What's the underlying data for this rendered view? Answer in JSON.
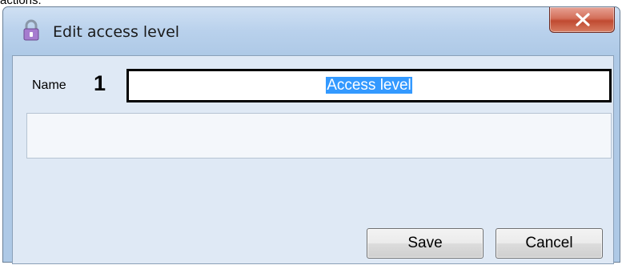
{
  "page_fragment_text": "actions:",
  "window": {
    "title": "Edit access level",
    "close_glyph": "x",
    "title_icon": "lock-icon",
    "close_icon": "close-icon"
  },
  "form": {
    "name_label": "Name",
    "step_marker": "1",
    "name_value": "Access level",
    "description_value": ""
  },
  "buttons": {
    "save": "Save",
    "cancel": "Cancel"
  },
  "colors": {
    "selection_highlight": "#3399ff",
    "close_button": "#c04a31",
    "frame": "#aec9e6"
  }
}
